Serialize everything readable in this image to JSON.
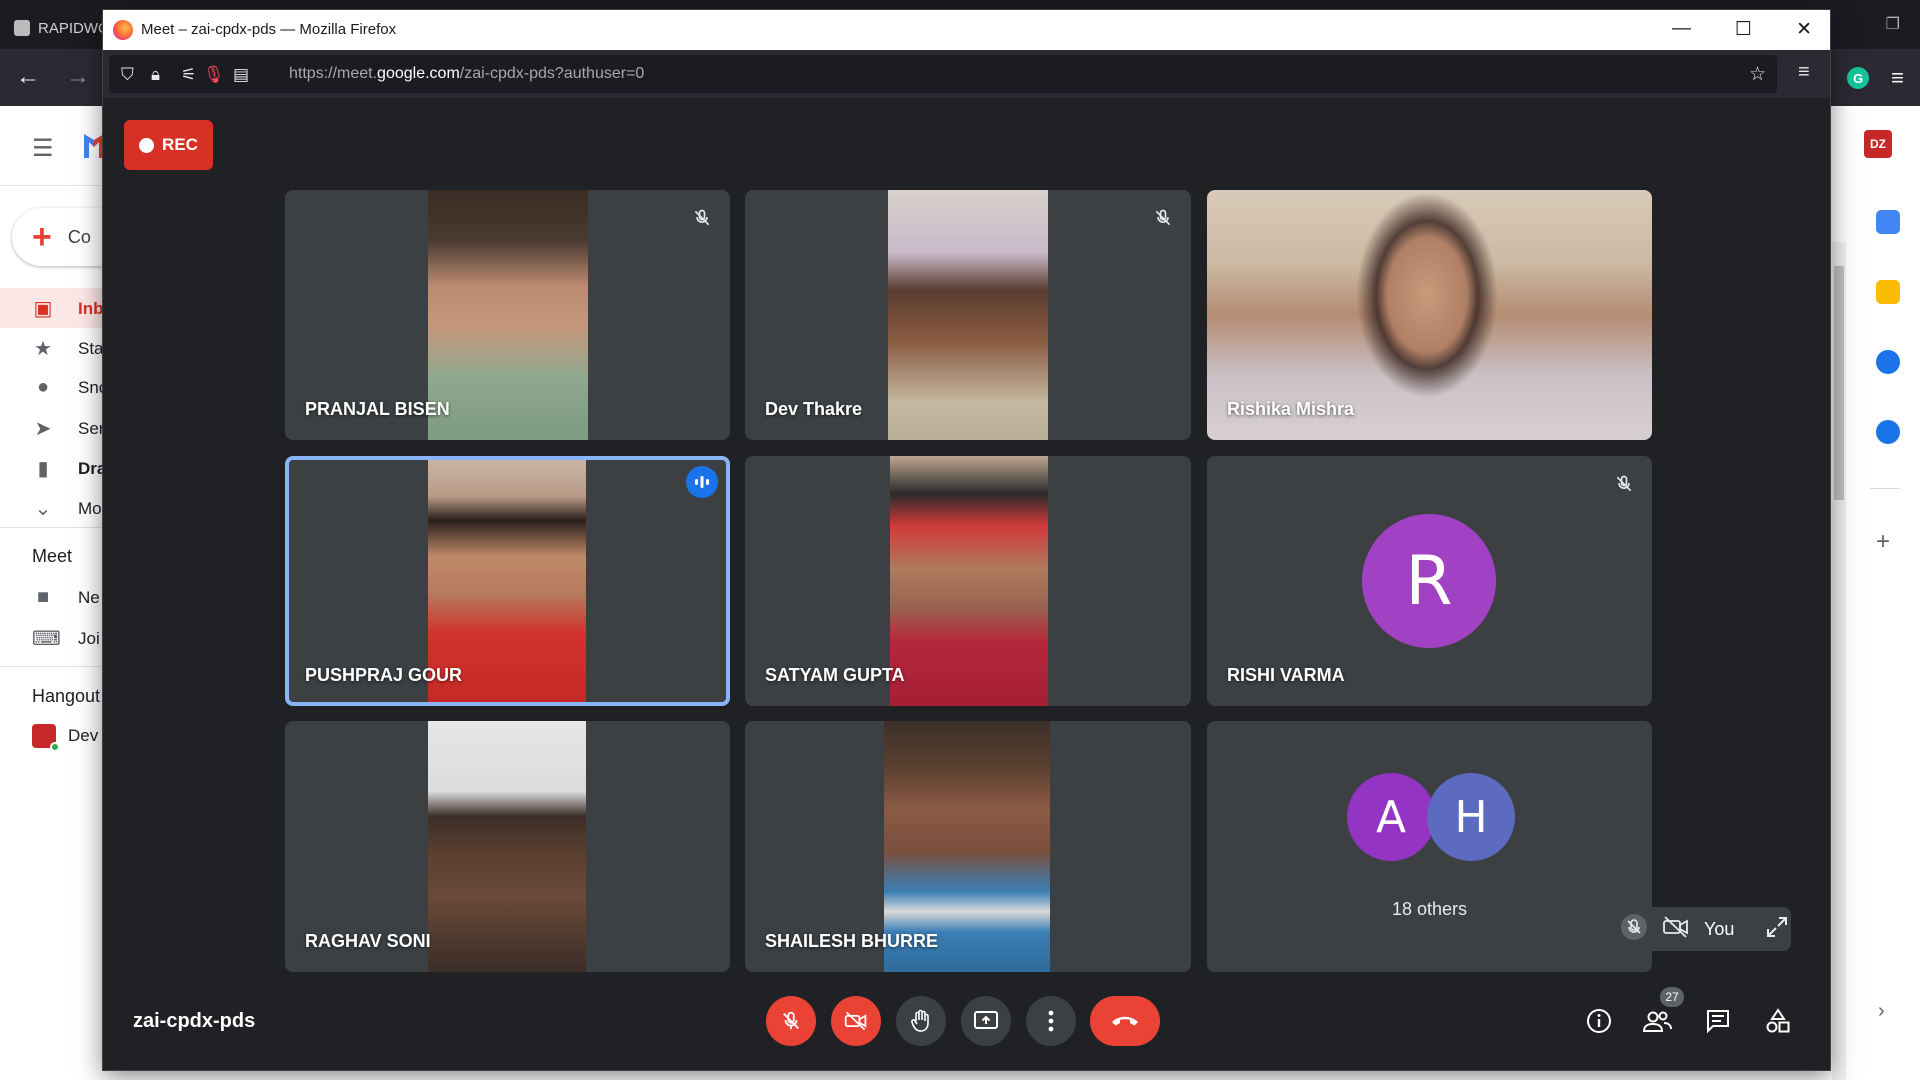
{
  "background_browser": {
    "tab_title": "RAPIDWC",
    "gmail": {
      "compose_label": "Co",
      "items": [
        {
          "label": "Inb",
          "icon": "inbox-icon"
        },
        {
          "label": "Sta",
          "icon": "star-icon"
        },
        {
          "label": "Sno",
          "icon": "clock-icon"
        },
        {
          "label": "Ser",
          "icon": "send-icon"
        },
        {
          "label": "Dra",
          "icon": "draft-icon"
        },
        {
          "label": "Mo",
          "icon": "chevron-down-icon"
        }
      ],
      "meet_section": "Meet",
      "meet_items": [
        {
          "label": "Ne",
          "icon": "video-icon"
        },
        {
          "label": "Joi",
          "icon": "keyboard-icon"
        }
      ],
      "hangouts_section": "Hangout",
      "hangouts_contact": "Dev"
    }
  },
  "popup": {
    "window_title": "Meet – zai-cpdx-pds — Mozilla Firefox",
    "url_prefix": "https://meet.",
    "url_domain": "google.com",
    "url_path": "/zai-cpdx-pds?authuser=0"
  },
  "meet": {
    "rec_label": "REC",
    "meeting_code": "zai-cpdx-pds",
    "participants": [
      {
        "name": "PRANJAL BISEN",
        "muted": true
      },
      {
        "name": "Dev Thakre",
        "muted": true
      },
      {
        "name": "Rishika Mishra",
        "muted": false
      },
      {
        "name": "PUSHPRAJ GOUR",
        "speaking": true
      },
      {
        "name": "SATYAM GUPTA",
        "muted": false
      },
      {
        "name": "RISHI VARMA",
        "muted": true,
        "initial": "R",
        "color": "#a142c5"
      },
      {
        "name": "RAGHAV SONI",
        "muted": false
      },
      {
        "name": "SHAILESH BHURRE",
        "muted": false
      }
    ],
    "others": {
      "initials": [
        "A",
        "H"
      ],
      "colors": [
        "#9334c4",
        "#5c6bc0"
      ],
      "label": "18 others"
    },
    "self_label": "You",
    "people_count": "27"
  },
  "colors": {
    "meet_bg": "#202124",
    "tile_bg": "#3c4043",
    "danger": "#ea4335",
    "rec": "#d93025",
    "active_border": "#8ab4f8"
  }
}
